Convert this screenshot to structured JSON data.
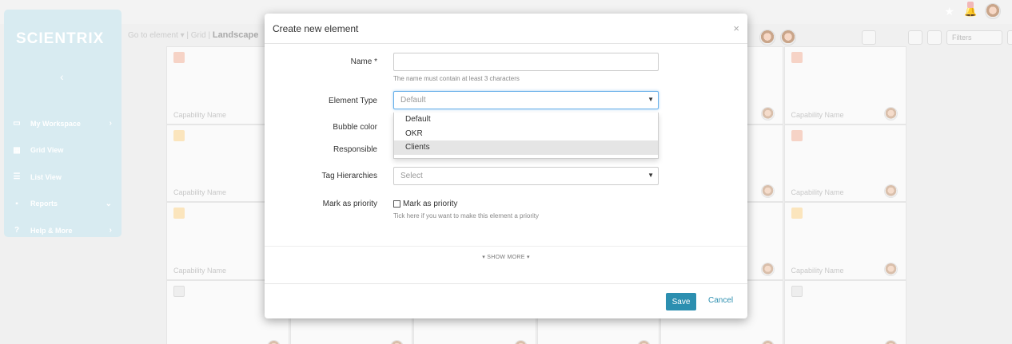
{
  "app": {
    "logo": "SCIENTRIX",
    "colors": {
      "sidebar": "#d8ebf1",
      "primary": "#2c8fb0",
      "focus": "#66afe9"
    }
  },
  "sidebar": {
    "collapse_icon": "chevron-left-icon",
    "items": [
      {
        "label": "My Workspace",
        "icon": "monitor-icon",
        "chevron": "›"
      },
      {
        "label": "Grid View",
        "icon": "grid-icon",
        "chevron": ""
      },
      {
        "label": "List View",
        "icon": "list-icon",
        "chevron": ""
      },
      {
        "label": "Reports",
        "icon": "briefcase-icon",
        "chevron": "⌄"
      },
      {
        "label": "Help & More",
        "icon": "help-icon",
        "chevron": "›"
      }
    ]
  },
  "toolbar": {
    "goto": "Go to element ▾",
    "sep": "| Grid |",
    "landscape": "Landscape",
    "filters": "Filters"
  },
  "grid": {
    "card_label": "Capability Name"
  },
  "modal": {
    "title": "Create new element",
    "close": "×",
    "name_label": "Name *",
    "name_value": "",
    "name_hint": "The name must contain at least 3 characters",
    "type_label": "Element Type",
    "type_value": "Default",
    "type_options": [
      "Default",
      "OKR",
      "Clients"
    ],
    "type_highlighted": "Clients",
    "bubble_label": "Bubble color",
    "responsible_label": "Responsible",
    "tags_label": "Tag Hierarchies",
    "tags_placeholder": "Select",
    "priority_label": "Mark as priority",
    "priority_checkbox_label": "Mark as priority",
    "priority_hint": "Tick here if you want to make this element a priority",
    "show_more": "▾ SHOW MORE ▾",
    "save": "Save",
    "cancel": "Cancel"
  }
}
